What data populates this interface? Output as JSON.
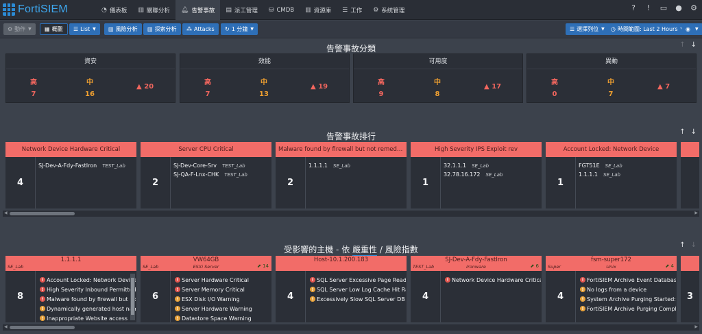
{
  "app": {
    "name": "FortiSIEM"
  },
  "nav": [
    {
      "label": "儀表板",
      "icon": "dashboard-icon"
    },
    {
      "label": "關聯分析",
      "icon": "chart-icon"
    },
    {
      "label": "告警事故",
      "icon": "bell-icon"
    },
    {
      "label": "派工管理",
      "icon": "ticket-icon"
    },
    {
      "label": "CMDB",
      "icon": "database-icon"
    },
    {
      "label": "資源庫",
      "icon": "chart-icon"
    },
    {
      "label": "工作",
      "icon": "list-icon"
    },
    {
      "label": "系統管理",
      "icon": "gear-icon"
    }
  ],
  "top_right_icons": [
    "help-icon",
    "alert-icon",
    "card-icon",
    "user-icon",
    "gear-icon"
  ],
  "toolbar": {
    "action": "動作",
    "overview": "概觀",
    "list": "List",
    "risk": "風險分析",
    "explore": "探索分析",
    "attacks": "Attacks",
    "refresh": "1 分鐘",
    "columns": "選擇列位",
    "time_range": "時間範圍: Last 2 Hours"
  },
  "categories_section": {
    "title": "告警事故分類"
  },
  "categories": [
    {
      "title": "資安",
      "high_label": "高",
      "high": "7",
      "mid_label": "中",
      "mid": "16",
      "trend": "20"
    },
    {
      "title": "效能",
      "high_label": "高",
      "high": "7",
      "mid_label": "中",
      "mid": "13",
      "trend": "19"
    },
    {
      "title": "可用度",
      "high_label": "高",
      "high": "9",
      "mid_label": "中",
      "mid": "8",
      "trend": "17"
    },
    {
      "title": "異動",
      "high_label": "高",
      "high": "0",
      "mid_label": "中",
      "mid": "7",
      "trend": "7"
    }
  ],
  "ranking_section": {
    "title": "告警事故排行"
  },
  "ranking": [
    {
      "title": "Network Device Hardware Critical",
      "count": "4",
      "rows": [
        {
          "host": "SJ-Dev-A-Fdy-FastIron",
          "org": "TEST_Lab"
        }
      ]
    },
    {
      "title": "Server CPU Critical",
      "count": "2",
      "rows": [
        {
          "host": "SJ-Dev-Core-Srv",
          "org": "TEST_Lab"
        },
        {
          "host": "SJ-QA-F-Lnx-CHK",
          "org": "TEST_Lab"
        }
      ]
    },
    {
      "title": "Malware found by firewall but not remediat...",
      "count": "2",
      "rows": [
        {
          "host": "1.1.1.1",
          "org": "SE_Lab"
        }
      ]
    },
    {
      "title": "High Severity IPS Exploit rev",
      "count": "1",
      "rows": [
        {
          "host": "32.1.1.1",
          "org": "SE_Lab"
        },
        {
          "host": "32.78.16.172",
          "org": "SE_Lab"
        }
      ]
    },
    {
      "title": "Account Locked: Network Device",
      "count": "1",
      "rows": [
        {
          "host": "FGT51E",
          "org": "SE_Lab"
        },
        {
          "host": "1.1.1.1",
          "org": "SE_Lab"
        }
      ]
    }
  ],
  "hosts_section": {
    "title_prefix": "受影響的主機 - 依",
    "sort_severity": "嚴重性",
    "separator": "/",
    "sort_risk": "風險指數"
  },
  "hosts": [
    {
      "name": "1.1.1.1",
      "org": "SE_Lab",
      "type": "",
      "trend": "",
      "count": "8",
      "incidents": [
        {
          "sev": "h",
          "text": "Account Locked: Network Device"
        },
        {
          "sev": "h",
          "text": "High Severity Inbound Permitted"
        },
        {
          "sev": "h",
          "text": "Malware found by firewall but not"
        },
        {
          "sev": "m",
          "text": "Dynamically generated host name"
        },
        {
          "sev": "m",
          "text": "Inappropriate Website access"
        }
      ]
    },
    {
      "name": "VW64GB",
      "org": "SE_Lab",
      "type": "ESXi Server",
      "trend": "14",
      "count": "6",
      "incidents": [
        {
          "sev": "h",
          "text": "Server Hardware Critical"
        },
        {
          "sev": "h",
          "text": "Server Memory Critical"
        },
        {
          "sev": "m",
          "text": "ESX Disk I/O Warning"
        },
        {
          "sev": "m",
          "text": "Server Hardware Warning"
        },
        {
          "sev": "m",
          "text": "Datastore Space Warning"
        }
      ]
    },
    {
      "name": "Host-10.1.200.183",
      "org": "",
      "type": "",
      "trend": "",
      "count": "4",
      "incidents": [
        {
          "sev": "h",
          "text": "SQL Server Excessive Page Read/W"
        },
        {
          "sev": "m",
          "text": "SQL Server Low Log Cache Hit Rat"
        },
        {
          "sev": "m",
          "text": "Excessively Slow SQL Server DB Qu"
        }
      ]
    },
    {
      "name": "SJ-Dev-A-Fdy-FastIron",
      "org": "TEST_Lab",
      "type": "Ironware",
      "trend": "6",
      "count": "4",
      "incidents": [
        {
          "sev": "h",
          "text": "Network Device Hardware Critical"
        }
      ]
    },
    {
      "name": "fsm-super172",
      "org": "Super",
      "type": "Unix",
      "trend": "4",
      "count": "4",
      "incidents": [
        {
          "sev": "h",
          "text": "FortiSIEM Archive Event Database"
        },
        {
          "sev": "m",
          "text": "No logs from a device"
        },
        {
          "sev": "m",
          "text": "System Archive Purging Started: P"
        },
        {
          "sev": "m",
          "text": "FortiSIEM Archive Purging Comple"
        }
      ]
    }
  ],
  "partial_host_count": "3",
  "colors": {
    "accent": "#2e6fb7",
    "card_header": "#f26c68",
    "high": "#f2665e",
    "medium": "#f0a030"
  }
}
